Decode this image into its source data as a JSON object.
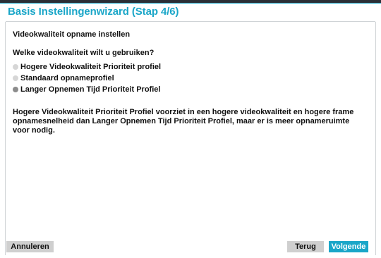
{
  "window": {
    "title": "Basis Instellingenwizard (Stap 4/6)"
  },
  "content": {
    "section_title": "Videokwaliteit opname instellen",
    "question": "Welke videokwaliteit wilt u gebruiken?",
    "options": [
      {
        "label": "Hogere Videokwaliteit Prioriteit profiel",
        "selected": false
      },
      {
        "label": "Standaard opnameprofiel",
        "selected": false
      },
      {
        "label": "Langer Opnemen Tijd Prioriteit Profiel",
        "selected": true
      }
    ],
    "description": "Hogere Videokwaliteit Prioriteit Profiel voorziet in een hogere videokwaliteit en hogere frame opnamesnelheid dan Langer Opnemen Tijd Prioriteit Profiel, maar er is meer opnameruimte voor nodig."
  },
  "footer": {
    "cancel_label": "Annuleren",
    "back_label": "Terug",
    "next_label": "Volgende"
  },
  "colors": {
    "accent": "#1aa6c8",
    "button_gray": "#cfcfcf",
    "radio_unselected": "#d6d6d6",
    "radio_selected": "#8c8c8c"
  }
}
